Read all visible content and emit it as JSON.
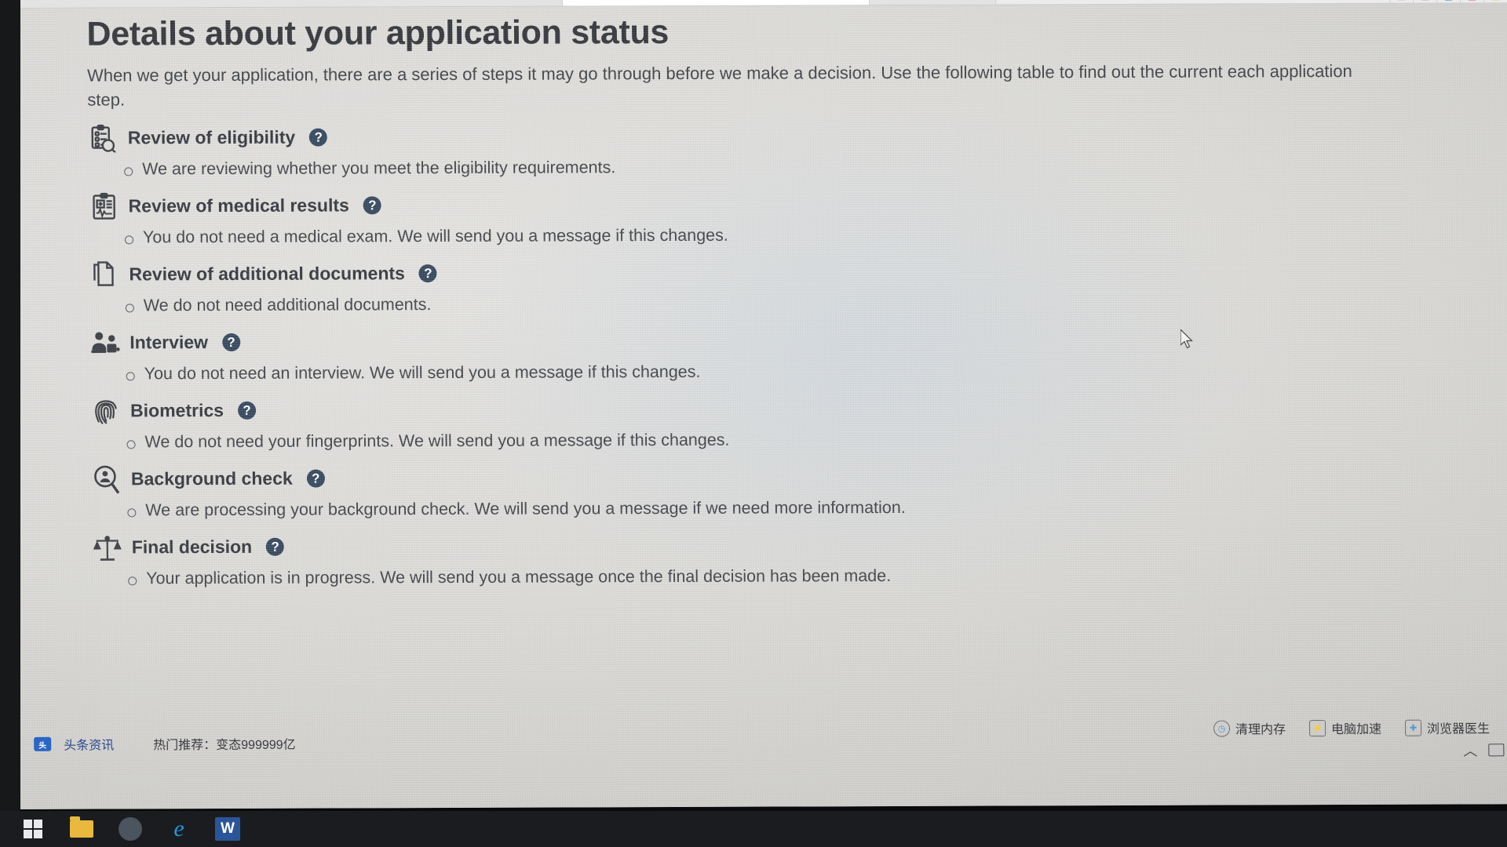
{
  "page": {
    "title": "Details about your application status",
    "intro": "When we get your application, there are a series of steps it may go through before we make a decision. Use the following table to find out the current each application step.",
    "help_badge": "?"
  },
  "steps": [
    {
      "icon": "clipboard-search-icon",
      "title": "Review of eligibility",
      "status": "We are reviewing whether you meet the eligibility requirements."
    },
    {
      "icon": "medical-clipboard-icon",
      "title": "Review of medical results",
      "status": "You do not need a medical exam. We will send you a message if this changes."
    },
    {
      "icon": "documents-copy-icon",
      "title": "Review of additional documents",
      "status": "We do not need additional documents."
    },
    {
      "icon": "people-interview-icon",
      "title": "Interview",
      "status": "You do not need an interview. We will send you a message if this changes."
    },
    {
      "icon": "fingerprint-icon",
      "title": "Biometrics",
      "status": "We do not need your fingerprints. We will send you a message if this changes."
    },
    {
      "icon": "person-magnifier-icon",
      "title": "Background check",
      "status": "We are processing your background check. We will send you a message if we need more information."
    },
    {
      "icon": "scales-balance-icon",
      "title": "Final decision",
      "status": "Your application is in progress. We will send you a message once the final decision has been made."
    }
  ],
  "browser_top": {
    "icons": [
      {
        "label": "",
        "color": "#d9d9d9"
      },
      {
        "label": "",
        "color": "#e0e0e0"
      },
      {
        "label": "",
        "color": "#2f8ed6"
      },
      {
        "label": "",
        "color": "#e04b4b"
      },
      {
        "label": "",
        "color": "#e8b93c"
      }
    ]
  },
  "widget_bar": [
    {
      "icon": "clock-icon",
      "label": "清理内存"
    },
    {
      "icon": "speed-icon",
      "label": "电脑加速"
    },
    {
      "icon": "doctor-icon",
      "label": "浏览器医生"
    }
  ],
  "ticker": {
    "logo_text": "头",
    "brand": "头条资讯",
    "hot": "热门推荐：变态999999亿"
  },
  "taskbar": {
    "items": [
      {
        "name": "start-button",
        "glyph": "start"
      },
      {
        "name": "file-explorer",
        "glyph": "folder"
      },
      {
        "name": "app-circle",
        "glyph": "circle"
      },
      {
        "name": "internet-explorer",
        "glyph": "e"
      },
      {
        "name": "word",
        "glyph": "W"
      }
    ]
  },
  "colors": {
    "badge": "#2f4256",
    "accent": "#1e9ee6",
    "text": "#3a3c40"
  }
}
